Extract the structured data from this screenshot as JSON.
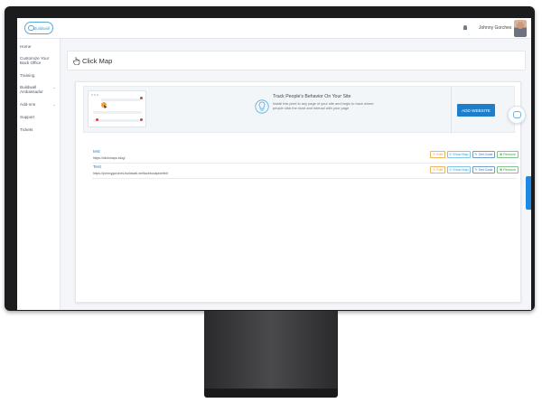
{
  "app": {
    "logo_text": "Buildwall"
  },
  "topbar": {
    "user_name": "Johnny Gorches"
  },
  "sidebar": {
    "items": [
      {
        "label": "Home"
      },
      {
        "label": "Customize Your Back Office"
      },
      {
        "label": "Training"
      },
      {
        "label": "Buildwall Ambassador"
      },
      {
        "label": "Add-ons"
      },
      {
        "label": "Support"
      },
      {
        "label": "Tickets"
      }
    ]
  },
  "page": {
    "title": "Click Map"
  },
  "banner": {
    "title": "Track People's Behavior On Your Site",
    "description": "Install this pixel to any page of your site and begin to track where people click the most and interact with your page",
    "add_button": "ADD WEBSITE"
  },
  "actions": {
    "edit": "Edit",
    "show_map": "Show Map",
    "get_code": "Get Code",
    "remove": "Remove"
  },
  "websites": [
    {
      "name": "test",
      "url": "https://clickmaps-blog/"
    },
    {
      "name": "Test",
      "url": "https://johnnygorches.buildwall.net/facebookpixelfeit"
    }
  ],
  "feedback": {
    "label": "Feedback"
  },
  "colors": {
    "primary": "#1f7ec9",
    "edit": "#e69a22",
    "show_map": "#2a9fd6",
    "get_code": "#2b6fb0",
    "remove": "#3aa04a"
  }
}
